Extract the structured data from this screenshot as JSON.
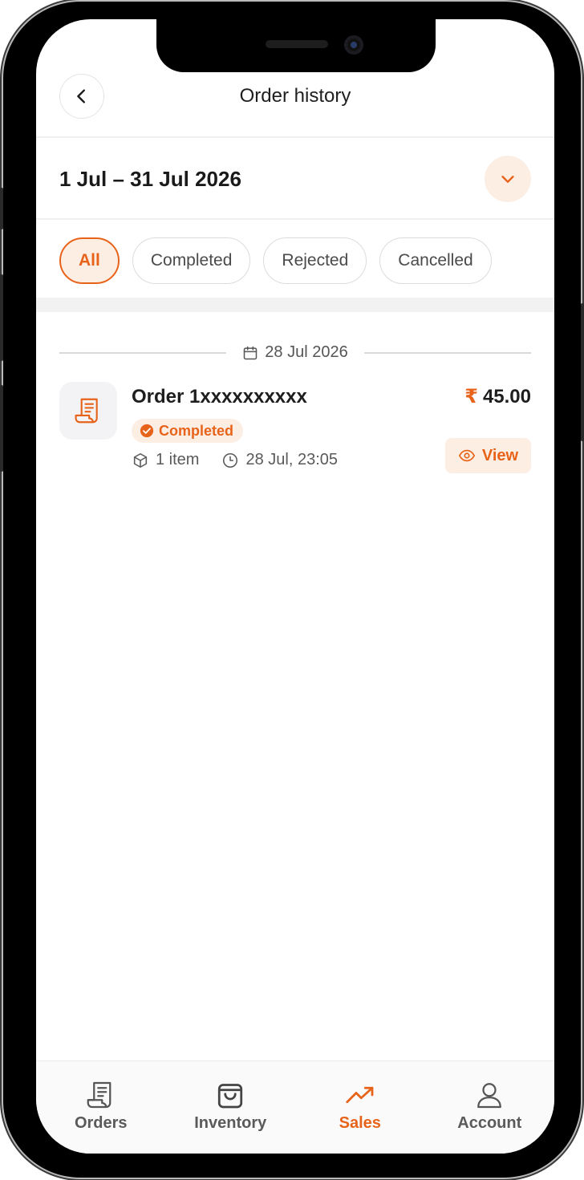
{
  "header": {
    "title": "Order history"
  },
  "date_range": {
    "label": "1 Jul – 31 Jul 2026"
  },
  "filters": [
    {
      "label": "All",
      "active": true
    },
    {
      "label": "Completed",
      "active": false
    },
    {
      "label": "Rejected",
      "active": false
    },
    {
      "label": "Cancelled",
      "active": false
    }
  ],
  "groups": [
    {
      "date": "28 Jul 2026",
      "orders": [
        {
          "name": "Order 1xxxxxxxxxx",
          "currency": "₹",
          "amount": "45.00",
          "status": "Completed",
          "items": "1 item",
          "time": "28 Jul, 23:05",
          "action": "View"
        }
      ]
    }
  ],
  "tabs": [
    {
      "label": "Orders",
      "icon": "receipt-icon"
    },
    {
      "label": "Inventory",
      "icon": "shopping-bag-icon"
    },
    {
      "label": "Sales",
      "icon": "trending-up-icon",
      "active": true
    },
    {
      "label": "Account",
      "icon": "user-icon"
    }
  ],
  "colors": {
    "accent": "#e8631a",
    "accent_light": "#fdeee4",
    "text": "#1e1e1e"
  }
}
